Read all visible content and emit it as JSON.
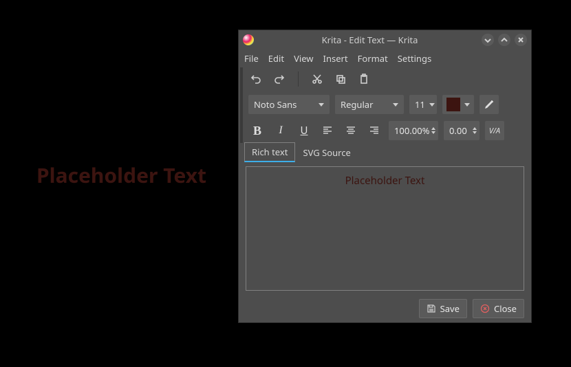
{
  "canvas": {
    "text": "Placeholder Text"
  },
  "window": {
    "title": "Krita - Edit Text — Krita",
    "menubar": {
      "file": "File",
      "edit": "Edit",
      "view": "View",
      "insert": "Insert",
      "format": "Format",
      "settings": "Settings"
    },
    "font": {
      "family": "Noto Sans",
      "weight": "Regular",
      "size": "11",
      "color": "#3c1410"
    },
    "lineheight": "100.00%",
    "letterspacing": "0.00",
    "tabs": {
      "rich": "Rich text",
      "svg": "SVG Source"
    },
    "editor_text": "Placeholder Text",
    "buttons": {
      "save": "Save",
      "close": "Close"
    }
  }
}
